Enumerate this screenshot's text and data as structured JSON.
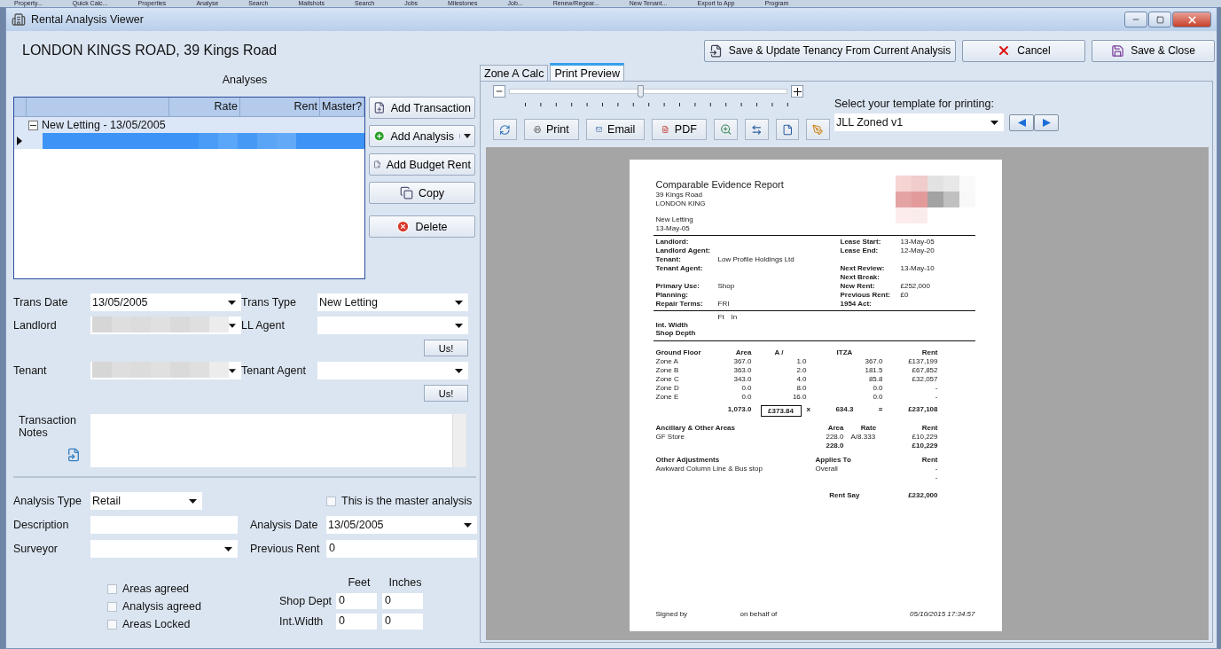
{
  "background_menu": [
    "Property...",
    "Quick Calc...",
    "Properties",
    "Analyse",
    "Search",
    "Mailshots",
    "Search",
    "Jobs",
    "Milestones",
    "Job...",
    "Renew/Regear...",
    "New Tenant...",
    "Export to App",
    "Program"
  ],
  "window": {
    "title": "Rental Analysis Viewer"
  },
  "header": {
    "address": "LONDON KINGS ROAD, 39 Kings Road",
    "buttons": [
      {
        "label": "Save & Update Tenancy From Current Analysis",
        "kind": "update"
      },
      {
        "label": "Cancel",
        "kind": "cancel"
      },
      {
        "label": "Save & Close",
        "kind": "save"
      }
    ]
  },
  "analyses": {
    "title": "Analyses",
    "columns": [
      "Rate",
      "Rent",
      "Master?"
    ],
    "groups": [
      {
        "label": "New Letting - 13/05/2005",
        "expanded": true,
        "children": [
          {
            "selected": true,
            "redacted": true
          }
        ]
      }
    ]
  },
  "analysis_buttons": [
    {
      "label": "Add Transaction",
      "kind": "transaction"
    },
    {
      "label": "Add Analysis",
      "kind": "analysis",
      "dropdown": true
    },
    {
      "label": "Add Budget Rent",
      "kind": "budget"
    },
    {
      "label": "Copy",
      "kind": "copy"
    },
    {
      "label": "Delete",
      "kind": "delete"
    }
  ],
  "transaction": {
    "rows": [
      {
        "left": {
          "label": "Trans Date",
          "value": "13/05/2005"
        },
        "right": {
          "label": "Trans Type",
          "value": "New Letting"
        }
      },
      {
        "left": {
          "label": "Landlord",
          "redacted": true
        },
        "right": {
          "label": "LL Agent",
          "action": "Us!"
        }
      },
      {
        "left": {
          "label": "Tenant",
          "redacted": true
        },
        "right": {
          "label": "Tenant Agent",
          "action": "Us!"
        }
      }
    ],
    "notes_label": "Transaction Notes"
  },
  "analysis": {
    "type_label": "Analysis Type",
    "type_value": "Retail",
    "master": {
      "label": "This is the master analysis",
      "checked": false
    },
    "description_label": "Description",
    "date_label": "Analysis Date",
    "date_value": "13/05/2005",
    "surveyor_label": "Surveyor",
    "previous_rent_label": "Previous Rent",
    "previous_rent": "0",
    "checks": [
      {
        "label": "Areas agreed",
        "checked": false
      },
      {
        "label": "Analysis agreed",
        "checked": false
      },
      {
        "label": "Areas Locked",
        "checked": false
      }
    ],
    "dims": {
      "columns": [
        "Feet",
        "Inches"
      ],
      "rows": [
        {
          "label": "Shop Dept",
          "feet": "0",
          "inches": "0"
        },
        {
          "label": "Int.Width",
          "feet": "0",
          "inches": "0"
        }
      ]
    }
  },
  "tabs": [
    {
      "label": "Zone A Calc",
      "selected": false
    },
    {
      "label": "Print Preview",
      "selected": true
    }
  ],
  "preview": {
    "zoom": {
      "level": 0.47
    },
    "tools": [
      {
        "kind": "refresh"
      },
      {
        "kind": "print",
        "label": "Print"
      },
      {
        "kind": "email",
        "label": "Email"
      },
      {
        "kind": "pdf",
        "label": "PDF"
      },
      {
        "kind": "zoom"
      },
      {
        "kind": "fit-width"
      },
      {
        "kind": "fit-page"
      },
      {
        "kind": "edit"
      }
    ],
    "template": {
      "label": "Select your template for printing:",
      "value": "JLL Zoned v1"
    }
  },
  "report": {
    "title": "Comparable Evidence Report",
    "logo_redacted": true,
    "address_lines": [
      "39 Kings Road",
      "LONDON KING"
    ],
    "sub_lines": [
      "New Letting",
      "13-May-05"
    ],
    "facts": [
      {
        "l": "Landlord:",
        "r": "Lease Start:",
        "rv": "13-May-05"
      },
      {
        "l": "Landlord Agent:",
        "r": "Lease End:",
        "rv": "12-May-20"
      },
      {
        "l": "Tenant:",
        "lv": "Low Profile Holdings Ltd"
      },
      {
        "l": "Tenant Agent:",
        "r": "Next Review:",
        "rv": "13-May-10"
      },
      {
        "r": "Next Break:"
      },
      {
        "l": "Primary Use:",
        "lv": "Shop",
        "r": "New Rent:",
        "rv": "£252,000"
      },
      {
        "l": "Planning:",
        "r": "Previous Rent:",
        "rv": "£0"
      },
      {
        "l": "Repair Terms:",
        "lv": "FRI",
        "r": "1954 Act:"
      }
    ],
    "dims": {
      "columns": [
        "Ft",
        "In"
      ],
      "rows": [
        "Int. Width",
        "Shop Depth"
      ]
    },
    "zones": {
      "columns": [
        "Ground Floor",
        "Area",
        "A /",
        "ITZA",
        "Rent"
      ],
      "rows": [
        [
          "Zone A",
          "367.0",
          "1.0",
          "367.0",
          "£137,199"
        ],
        [
          "Zone B",
          "363.0",
          "2.0",
          "181.5",
          "£67,852"
        ],
        [
          "Zone C",
          "343.0",
          "4.0",
          "85.8",
          "£32,057"
        ],
        [
          "Zone D",
          "0.0",
          "8.0",
          "0.0",
          "-"
        ],
        [
          "Zone E",
          "0.0",
          "16.0",
          "0.0",
          "-"
        ]
      ],
      "totals": {
        "area": "1,073.0",
        "rate": "£373.84",
        "times": "x",
        "itza": "634.3",
        "equals": "=",
        "rent": "£237,108"
      }
    },
    "ancillary": {
      "columns": [
        "Ancillary & Other Areas",
        "Area",
        "Rate",
        "Rent"
      ],
      "rows": [
        [
          "GF Store",
          "228.0",
          "A/8.333",
          "£10,229"
        ]
      ],
      "total_area": "228.0",
      "total_rent": "£10,229"
    },
    "adjustments": {
      "columns": [
        "Other Adjustments",
        "Applies To",
        "Rent"
      ],
      "rows": [
        [
          "Awkward Column Line & Bus stop",
          "Overall",
          "-"
        ]
      ],
      "total": "-"
    },
    "rent_say": {
      "label": "Rent Say",
      "value": "£232,000"
    },
    "footer": {
      "signed": "Signed by",
      "behalf": "on behalf of",
      "stamp": "05/10/2015 17:34:57"
    }
  }
}
